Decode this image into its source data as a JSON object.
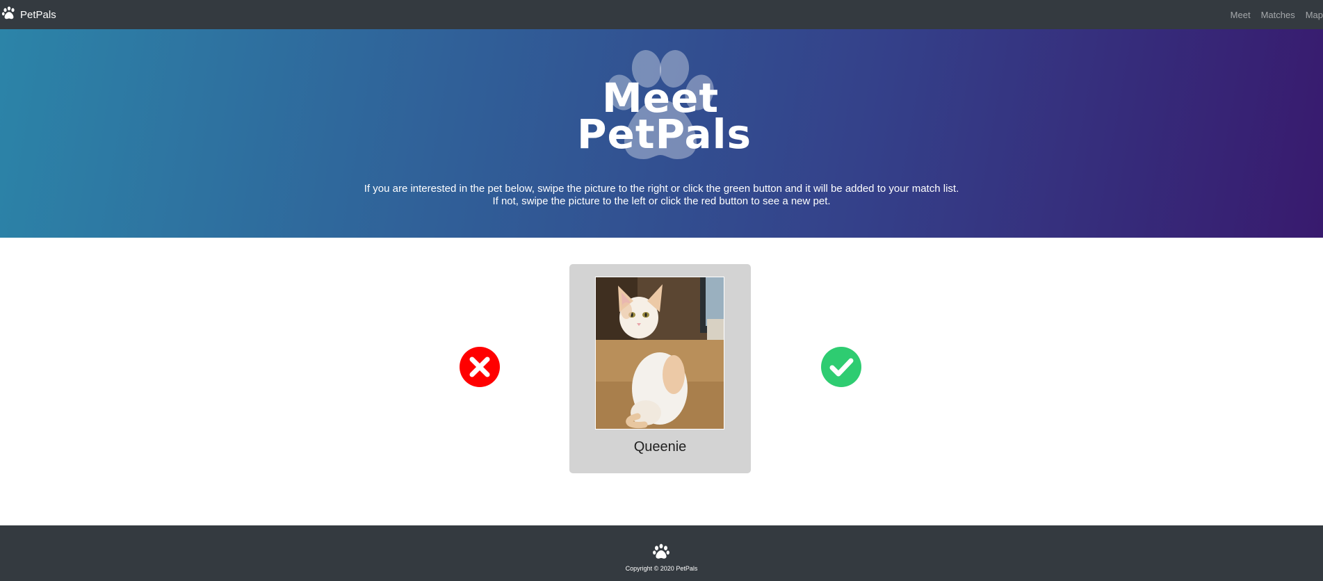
{
  "navbar": {
    "brand": "PetPals",
    "links": [
      "Meet",
      "Matches",
      "Map"
    ]
  },
  "hero": {
    "title_line1": "Meet",
    "title_line2": "PetPals",
    "instructions_line1": "If you are interested in the pet below, swipe the picture to the right or click the green button and it will be added to your match list.",
    "instructions_line2": "If not, swipe the picture to the left or click the red button to see a new pet."
  },
  "pet": {
    "name": "Queenie"
  },
  "actions": {
    "reject_icon": "x-circle-icon",
    "accept_icon": "check-circle-icon"
  },
  "footer": {
    "copyright": "Copyright © 2020 PetPals"
  },
  "colors": {
    "navbar_bg": "#343a40",
    "reject": "#ff0000",
    "accept": "#2ecc71",
    "card_bg": "#d3d3d3"
  }
}
